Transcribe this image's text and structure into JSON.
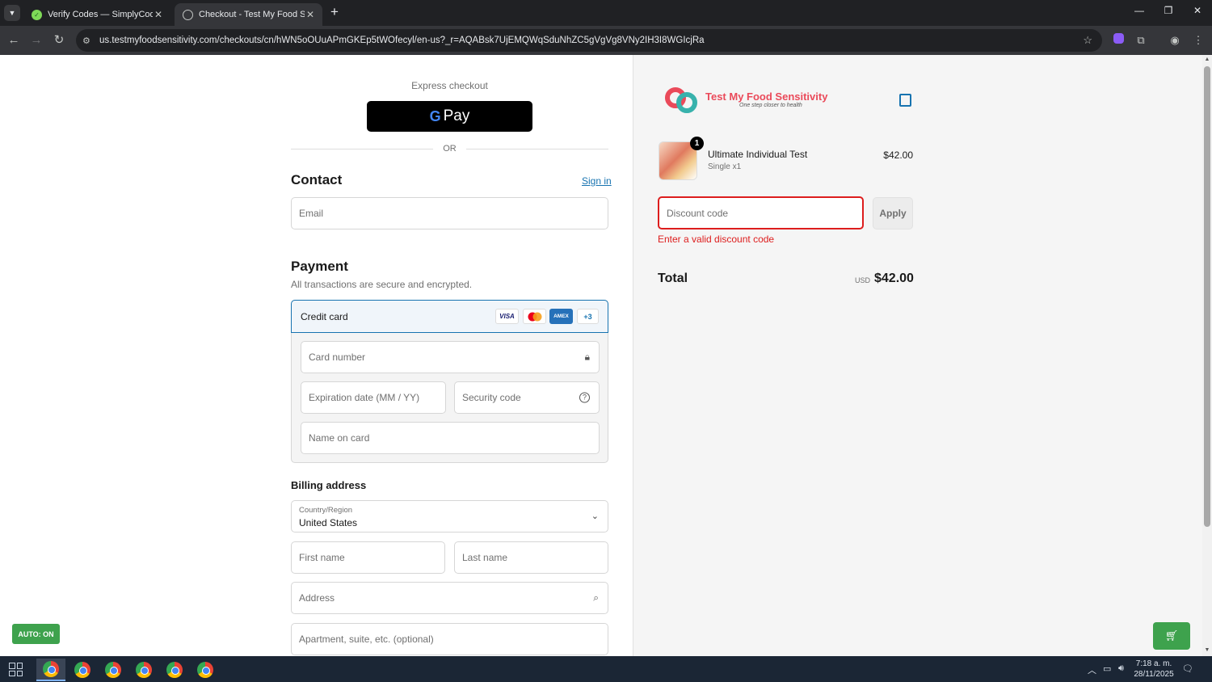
{
  "browser": {
    "tabs": [
      {
        "title": "Verify Codes — SimplyCodes",
        "active": false
      },
      {
        "title": "Checkout - Test My Food Sensitivity",
        "active": true
      }
    ],
    "url": "us.testmyfoodsensitivity.com/checkouts/cn/hWN5oOUuAPmGKEp5tWOfecyl/en-us?_r=AQABsk7UjEMQWqSduNhZC5gVgVg8VNy2IH3I8WGIcjRa"
  },
  "checkout": {
    "express_label": "Express checkout",
    "gpay_label": "Pay",
    "or_label": "OR",
    "contact": {
      "heading": "Contact",
      "sign_in": "Sign in",
      "email_placeholder": "Email"
    },
    "payment": {
      "heading": "Payment",
      "subtitle": "All transactions are secure and encrypted.",
      "method_label": "Credit card",
      "card_brands": [
        "VISA",
        "AMEX",
        "+3"
      ],
      "card_number_placeholder": "Card number",
      "expiry_placeholder": "Expiration date (MM / YY)",
      "security_placeholder": "Security code",
      "name_placeholder": "Name on card"
    },
    "billing": {
      "heading": "Billing address",
      "country_label": "Country/Region",
      "country_value": "United States",
      "first_name_placeholder": "First name",
      "last_name_placeholder": "Last name",
      "address_placeholder": "Address",
      "apartment_placeholder": "Apartment, suite, etc. (optional)"
    }
  },
  "summary": {
    "brand_name": "Test My Food Sensitivity",
    "brand_tagline": "One step closer to health",
    "item": {
      "name": "Ultimate Individual Test",
      "variant": "Single x1",
      "price": "$42.00",
      "quantity": "1"
    },
    "discount_placeholder": "Discount code",
    "apply_label": "Apply",
    "discount_error": "Enter a valid discount code",
    "total_label": "Total",
    "total_currency": "USD",
    "total_value": "$42.00"
  },
  "extension": {
    "auto_badge": "AUTO: ON"
  },
  "taskbar": {
    "time": "7:18 a. m.",
    "date": "28/11/2025"
  },
  "colors": {
    "error": "#dd1d1d",
    "link": "#1773b0",
    "extension_green": "#3ea24d"
  }
}
